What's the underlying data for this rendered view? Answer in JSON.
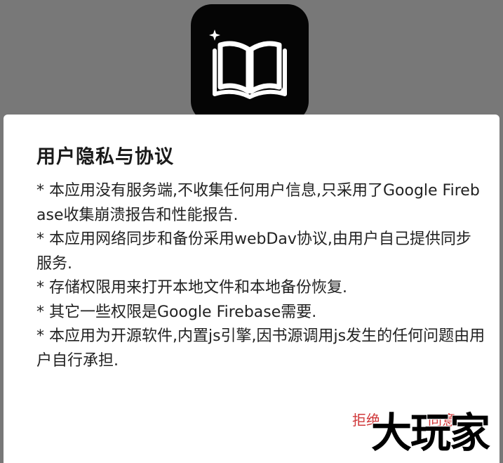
{
  "background": {
    "scrim_color": "#787878",
    "app_icon": {
      "icon": "open-book-icon",
      "background_color": "#050505",
      "foreground_color": "#ffffff"
    }
  },
  "dialog": {
    "title": "用户隐私与协议",
    "paragraphs": [
      "* 本应用没有服务端,不收集任何用户信息,只采用了Google Firebase收集崩溃报告和性能报告.",
      "* 本应用网络同步和备份采用webDav协议,由用户自己提供同步服务.",
      "* 存储权限用来打开本地文件和本地备份恢复.",
      "* 其它一些权限是Google Firebase需要.",
      "* 本应用为开源软件,内置js引擎,因书源调用js发生的任何问题由用户自行承担."
    ],
    "buttons": {
      "reject_label": "拒绝",
      "agree_label": "同意"
    },
    "accent_color": "#d0393b"
  },
  "watermark": {
    "text": "大玩家"
  }
}
